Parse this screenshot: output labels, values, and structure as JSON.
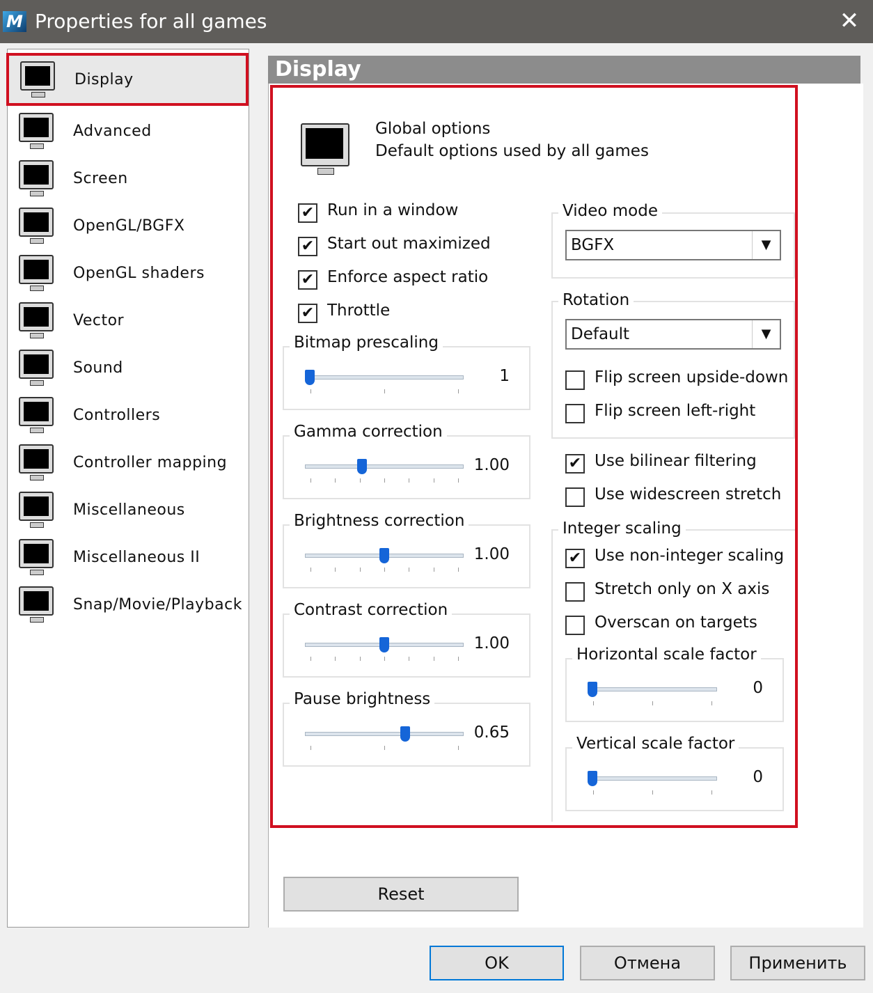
{
  "window": {
    "title": "Properties for all games",
    "app_icon": "mame-logo",
    "close_icon": "close-icon"
  },
  "sidebar": {
    "items": [
      {
        "label": "Display",
        "icon": "monitor-icon",
        "selected": true
      },
      {
        "label": "Advanced",
        "icon": "advanced-icon"
      },
      {
        "label": "Screen",
        "icon": "network-screens-icon"
      },
      {
        "label": "OpenGL/BGFX",
        "icon": "opengl-icon"
      },
      {
        "label": "OpenGL shaders",
        "icon": "shaders-icon"
      },
      {
        "label": "Vector",
        "icon": "vector-icon"
      },
      {
        "label": "Sound",
        "icon": "speaker-icon"
      },
      {
        "label": "Controllers",
        "icon": "keyboard-icon"
      },
      {
        "label": "Controller mapping",
        "icon": "joystick-icon"
      },
      {
        "label": "Miscellaneous",
        "icon": "misc-icon"
      },
      {
        "label": "Miscellaneous II",
        "icon": "notepad-icon"
      },
      {
        "label": "Snap/Movie/Playback",
        "icon": "snapshot-icon"
      }
    ]
  },
  "panel": {
    "title": "Display",
    "header_line1": "Global options",
    "header_line2": "Default options used by all games",
    "checks_left": [
      {
        "label": "Run in a window",
        "checked": true
      },
      {
        "label": "Start out maximized",
        "checked": true
      },
      {
        "label": "Enforce aspect ratio",
        "checked": true
      },
      {
        "label": "Throttle",
        "checked": true
      }
    ],
    "sliders": [
      {
        "label": "Bitmap prescaling",
        "value": "1",
        "fraction": 0
      },
      {
        "label": "Gamma correction",
        "value": "1.00",
        "fraction": 0.35
      },
      {
        "label": "Brightness correction",
        "value": "1.00",
        "fraction": 0.5
      },
      {
        "label": "Contrast correction",
        "value": "1.00",
        "fraction": 0.5
      },
      {
        "label": "Pause brightness",
        "value": "0.65",
        "fraction": 0.64
      }
    ],
    "video_mode": {
      "label": "Video mode",
      "value": "BGFX"
    },
    "rotation": {
      "label": "Rotation",
      "value": "Default"
    },
    "flip": [
      {
        "label": "Flip screen upside-down",
        "checked": false
      },
      {
        "label": "Flip screen left-right",
        "checked": false
      }
    ],
    "filter": [
      {
        "label": "Use bilinear filtering",
        "checked": true
      },
      {
        "label": "Use widescreen stretch",
        "checked": false
      }
    ],
    "integer_scaling": {
      "label": "Integer scaling",
      "checks": [
        {
          "label": "Use non-integer scaling",
          "checked": true
        },
        {
          "label": "Stretch only on X axis",
          "checked": false
        },
        {
          "label": "Overscan on targets",
          "checked": false
        }
      ],
      "sliders": [
        {
          "label": "Horizontal scale factor",
          "value": "0",
          "fraction": 0
        },
        {
          "label": "Vertical scale factor",
          "value": "0",
          "fraction": 0
        }
      ]
    },
    "reset": "Reset"
  },
  "buttons": {
    "ok": "OK",
    "cancel": "Отмена",
    "apply": "Применить"
  }
}
